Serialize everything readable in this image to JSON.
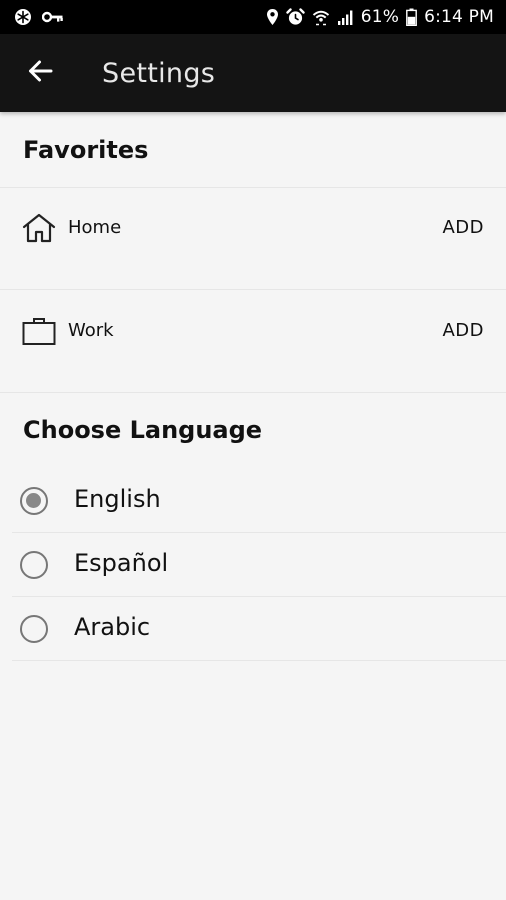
{
  "status_bar": {
    "battery": "61%",
    "time": "6:14 PM",
    "icons": [
      "app-notification-icon",
      "key-icon",
      "location-icon",
      "alarm-icon",
      "wifi-icon",
      "signal-icon",
      "battery-icon"
    ]
  },
  "header": {
    "back_icon": "back-arrow-icon",
    "title": "Settings"
  },
  "favorites": {
    "heading": "Favorites",
    "items": [
      {
        "icon": "home-icon",
        "label": "Home",
        "action": "ADD"
      },
      {
        "icon": "briefcase-icon",
        "label": "Work",
        "action": "ADD"
      }
    ]
  },
  "language": {
    "heading": "Choose Language",
    "selected": "English",
    "options": [
      {
        "label": "English",
        "checked": true
      },
      {
        "label": "Español",
        "checked": false
      },
      {
        "label": "Arabic",
        "checked": false
      }
    ]
  },
  "colors": {
    "status_bar_bg": "#000000",
    "app_bar_bg": "#141414",
    "page_bg": "#f5f5f5",
    "radio_fill": "#888888"
  }
}
